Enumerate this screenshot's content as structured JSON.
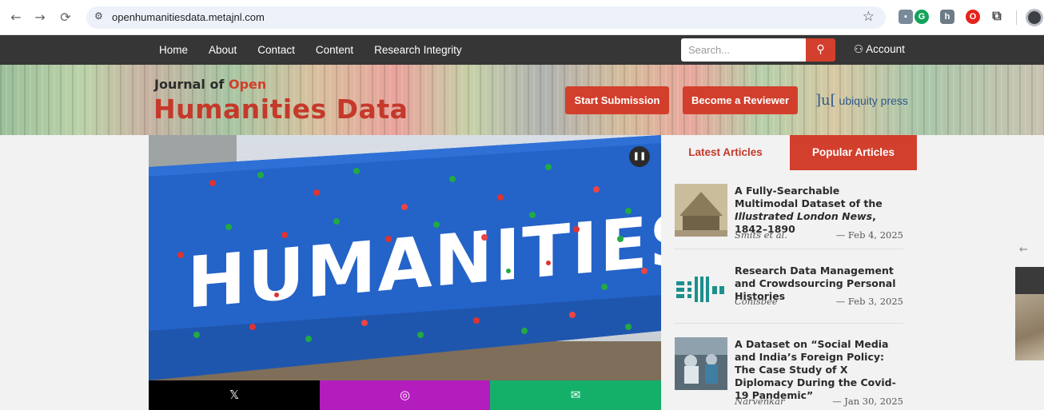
{
  "browser": {
    "url": "openhumanitiesdata.metajnl.com"
  },
  "nav": {
    "links": [
      "Home",
      "About",
      "Contact",
      "Content",
      "Research Integrity"
    ],
    "search_placeholder": "Search...",
    "account_label": "Account"
  },
  "banner": {
    "logo_prefix": "Journal of",
    "logo_open": "Open",
    "logo_main": "Humanities Data",
    "start_submission": "Start Submission",
    "become_reviewer": "Become a Reviewer",
    "publisher": "ubiquity press"
  },
  "hero": {
    "sign_text": "HUMANITIES"
  },
  "tabs": {
    "latest": "Latest Articles",
    "popular": "Popular Articles"
  },
  "articles": [
    {
      "title_pre": "A Fully-Searchable Multimodal Dataset of the ",
      "title_em": "Illustrated London News",
      "title_post": ", 1842–1890",
      "authors": "Smits et al.",
      "date": "— Feb 4, 2025"
    },
    {
      "title": "Research Data Management and Crowdsourcing Personal Histories",
      "authors": "Conisbee",
      "date": "— Feb 3, 2025"
    },
    {
      "title": "A Dataset on “Social Media and India’s Foreign Policy: The Case Study of X Diplomacy During the Covid-19 Pandemic”",
      "authors": "Narvenkar",
      "date": "— Jan 30, 2025"
    }
  ],
  "colors": {
    "nav_bg": "#363636",
    "accent_red": "#d23f2c",
    "share_x": "#000000",
    "share_instagram": "#b41dbd",
    "share_email": "#14b06a"
  }
}
